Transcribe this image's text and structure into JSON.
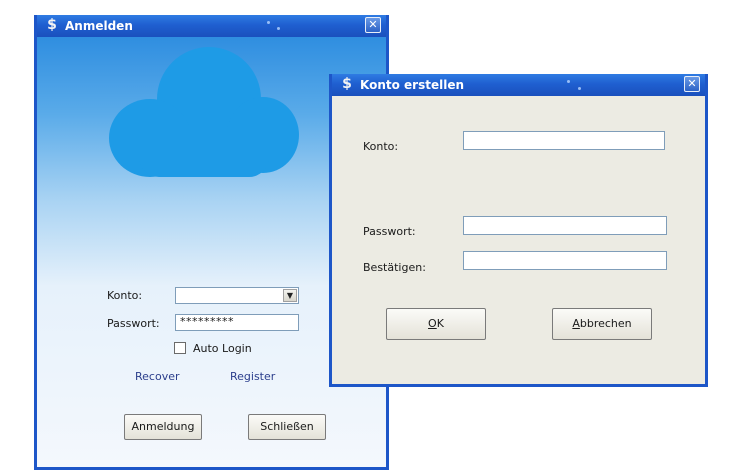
{
  "login_window": {
    "title": "Anmelden",
    "app_icon": "dollar-app-icon",
    "close_glyph": "✕",
    "account_label": "Konto:",
    "account_value": "",
    "password_label": "Passwort:",
    "password_value": "*********",
    "auto_login_label": "Auto Login",
    "auto_login_checked": false,
    "recover_link": "Recover",
    "register_link": "Register",
    "login_button": "Anmeldung",
    "close_button": "Schließen",
    "colors": {
      "titlebar": "#1f5fd0",
      "cloud": "#1e9be6",
      "sky_top": "#2f8ee0"
    }
  },
  "create_window": {
    "title": "Konto erstellen",
    "app_icon": "dollar-app-icon",
    "close_glyph": "✕",
    "account_label": "Konto:",
    "account_value": "",
    "password_label": "Passwort:",
    "password_value": "",
    "confirm_label": "Bestätigen:",
    "confirm_value": "",
    "ok_button": {
      "mnemonic": "O",
      "rest": "K"
    },
    "cancel_button": {
      "mnemonic": "A",
      "rest": "bbrechen"
    },
    "colors": {
      "client_bg": "#ecebe3"
    }
  }
}
